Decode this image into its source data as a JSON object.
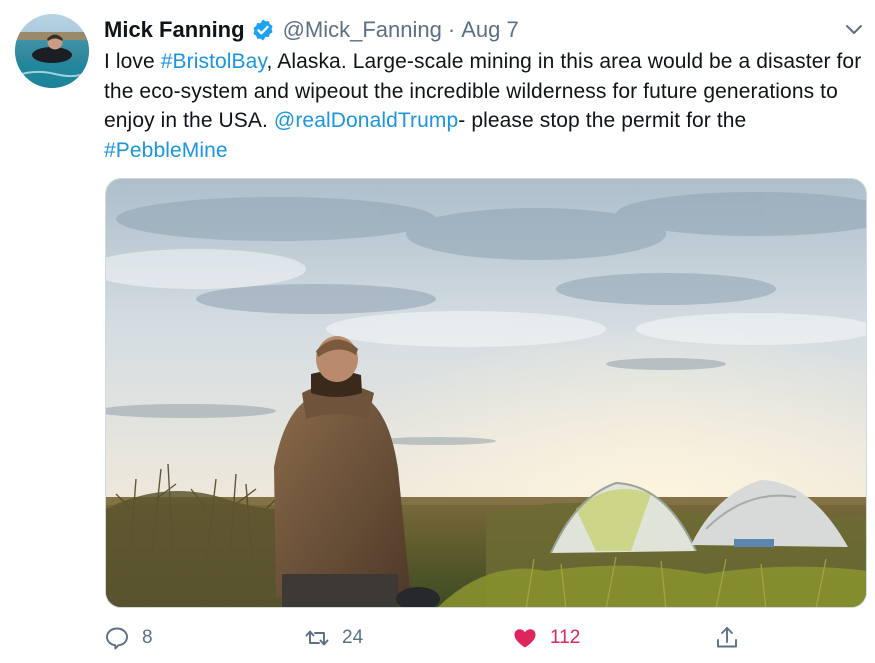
{
  "tweet": {
    "author": {
      "display_name": "Mick Fanning",
      "handle": "@Mick_Fanning",
      "verified": true,
      "avatar": "avatar-surfer-in-water"
    },
    "separator": "·",
    "timestamp": "Aug 7",
    "text_segments": [
      {
        "text": "I love ",
        "type": "text"
      },
      {
        "text": "#BristolBay",
        "type": "hashtag"
      },
      {
        "text": ", Alaska. Large-scale mining in this area would be a disaster for the eco-system and wipeout the incredible wilderness for future generations to enjoy in the USA. ",
        "type": "text"
      },
      {
        "text": "@realDonaldTrump",
        "type": "mention"
      },
      {
        "text": "- please stop the permit for the ",
        "type": "text"
      },
      {
        "text": "#PebbleMine",
        "type": "hashtag"
      }
    ],
    "media": {
      "icon": "photo-man-standing-by-tents-at-sunset"
    },
    "actions": {
      "reply_count": "8",
      "retweet_count": "24",
      "like_count": "112"
    }
  },
  "colors": {
    "link": "#1b95e0",
    "secondary_text": "#5b7083",
    "like_active": "#e0245e",
    "verified": "#1da1f2"
  },
  "icons": [
    "verified-badge-icon",
    "chevron-down-icon",
    "reply-icon",
    "retweet-icon",
    "like-icon",
    "share-icon"
  ]
}
